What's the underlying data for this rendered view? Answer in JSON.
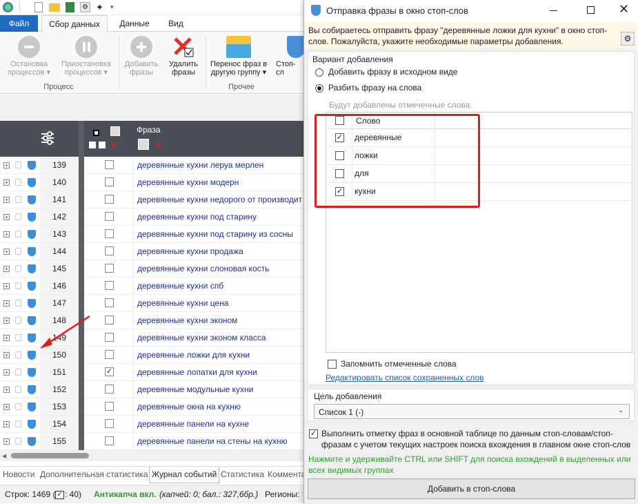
{
  "ribbon": {
    "tabs": {
      "file": "Файл",
      "collect": "Сбор данных",
      "data": "Данные",
      "view": "Вид"
    },
    "buttons": {
      "stop": "Остановка процессов",
      "pause": "Приостановка процессов",
      "add": "Добавить фразы",
      "delete": "Удалить фразы",
      "move": "Перенос фраз в другую группу",
      "stop_words": "Стоп-сл"
    },
    "groups": {
      "process": "Процесс",
      "other": "Прочее"
    }
  },
  "grid": {
    "phrase_header": "Фраза",
    "rows": [
      {
        "num": "139",
        "checked": false,
        "phrase": "деревянные кухни леруа мерлен"
      },
      {
        "num": "140",
        "checked": false,
        "phrase": "деревянные кухни модерн"
      },
      {
        "num": "141",
        "checked": false,
        "phrase": "деревянные кухни недорого от производит"
      },
      {
        "num": "142",
        "checked": false,
        "phrase": "деревянные кухни под старину"
      },
      {
        "num": "143",
        "checked": false,
        "phrase": "деревянные кухни под старину из сосны"
      },
      {
        "num": "144",
        "checked": false,
        "phrase": "деревянные кухни продажа"
      },
      {
        "num": "145",
        "checked": false,
        "phrase": "деревянные кухни слоновая кость"
      },
      {
        "num": "146",
        "checked": false,
        "phrase": "деревянные кухни спб"
      },
      {
        "num": "147",
        "checked": false,
        "phrase": "деревянные кухни цена"
      },
      {
        "num": "148",
        "checked": false,
        "phrase": "деревянные кухни эконом"
      },
      {
        "num": "149",
        "checked": false,
        "phrase": "деревянные кухни эконом класса"
      },
      {
        "num": "150",
        "checked": false,
        "phrase": "деревянные ложки для кухни"
      },
      {
        "num": "151",
        "checked": true,
        "phrase": "деревянные лопатки для кухни"
      },
      {
        "num": "152",
        "checked": false,
        "phrase": "деревянные модульные кухни"
      },
      {
        "num": "153",
        "checked": false,
        "phrase": "деревянные окна на кухню"
      },
      {
        "num": "154",
        "checked": false,
        "phrase": "деревянные панели на кухне"
      },
      {
        "num": "155",
        "checked": false,
        "phrase": "деревянные панели на стены на кухню"
      }
    ]
  },
  "bottom_tabs": [
    "Новости",
    "Дополнительная статистика",
    "Журнал событий",
    "Статистика",
    "Коммента"
  ],
  "status": {
    "rows_label": "Строк: 1469 (",
    "rows_suffix": ": 40)",
    "anticaptcha": "Антикапча вкл.",
    "captcha_info": "(капчей: 0; бал.: 327,6бр.)",
    "regions": "Регионы:"
  },
  "dialog": {
    "title": "Отправка фразы в окно стоп-слов",
    "info": "Вы собираетесь отправить фразу \"деревянные ложки для кухни\" в окно стоп-слов. Пожалуйста, укажите необходимые параметры добавления.",
    "variant_label": "Вариант добавления",
    "option_whole": "Добавить фразу в исходном виде",
    "option_split": "Разбить фразу на слова",
    "hint": "Будут добавлены отмеченные слова.",
    "word_header": "Слово",
    "words": [
      {
        "word": "деревянные",
        "checked": true
      },
      {
        "word": "ложки",
        "checked": false
      },
      {
        "word": "для",
        "checked": false
      },
      {
        "word": "кухни",
        "checked": true
      }
    ],
    "remember": "Запомнить отмеченные слова",
    "edit_link": "Редактировать список сохраненных слов",
    "target_label": "Цель добавления",
    "target_value": "Список 1 (-)",
    "mark_option": "Выполнить отметку фраз в основной таблице по данным стоп-словам/стоп-фразам с учетом текущих настроек поиска вхождения в главном окне стоп-слов",
    "green_hint": "Нажмите и удерживайте CTRL или SHIFT для поиска вхождений в выделенных или всех видимых группах",
    "submit": "Добавить в стоп-слова"
  },
  "colors": {
    "accent": "#1f6bbf",
    "highlight": "#e01b1b",
    "green": "#2e9e2e",
    "link": "#1a5fb4"
  }
}
